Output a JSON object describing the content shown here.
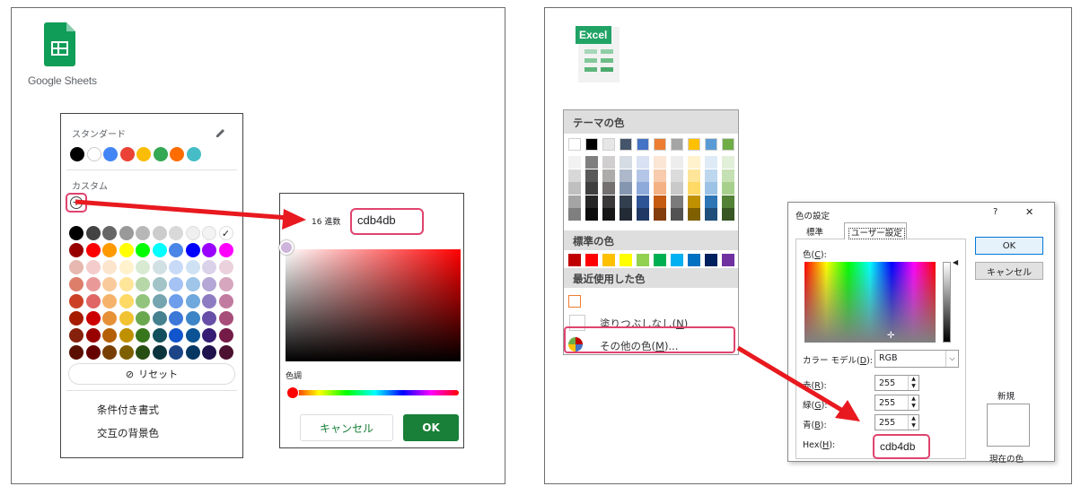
{
  "google": {
    "brand": "Google Sheets",
    "palette": {
      "section_standard": "スタンダード",
      "standard_colors": [
        "#000000",
        "#ffffff",
        "#4285f4",
        "#ea4335",
        "#fbbc04",
        "#34a853",
        "#ff6d01",
        "#46bdc6"
      ],
      "section_custom": "カスタム",
      "grid": [
        [
          "#000000",
          "#434343",
          "#666666",
          "#999999",
          "#b7b7b7",
          "#cccccc",
          "#d9d9d9",
          "#efefef",
          "#f3f3f3",
          "#ffffff"
        ],
        [
          "#980000",
          "#ff0000",
          "#ff9900",
          "#ffff00",
          "#00ff00",
          "#00ffff",
          "#4a86e8",
          "#0000ff",
          "#9900ff",
          "#ff00ff"
        ],
        [
          "#e6b8af",
          "#f4cccc",
          "#fce5cd",
          "#fff2cc",
          "#d9ead3",
          "#d0e0e3",
          "#c9daf8",
          "#cfe2f3",
          "#d9d2e9",
          "#ead1dc"
        ],
        [
          "#dd7e6b",
          "#ea9999",
          "#f9cb9c",
          "#ffe599",
          "#b6d7a8",
          "#a2c4c9",
          "#a4c2f4",
          "#9fc5e8",
          "#b4a7d6",
          "#d5a6bd"
        ],
        [
          "#cc4125",
          "#e06666",
          "#f6b26b",
          "#ffd966",
          "#93c47d",
          "#76a5af",
          "#6d9eeb",
          "#6fa8dc",
          "#8e7cc3",
          "#c27ba0"
        ],
        [
          "#a61c00",
          "#cc0000",
          "#e69138",
          "#f1c232",
          "#6aa84f",
          "#45818e",
          "#3c78d8",
          "#3d85c6",
          "#674ea7",
          "#a64d79"
        ],
        [
          "#85200c",
          "#990000",
          "#b45f06",
          "#bf9000",
          "#38761d",
          "#134f5c",
          "#1155cc",
          "#0b5394",
          "#351c75",
          "#741b47"
        ],
        [
          "#5b0f00",
          "#660000",
          "#783f04",
          "#7f6000",
          "#274e13",
          "#0c343d",
          "#1c4587",
          "#073763",
          "#20124d",
          "#4c1130"
        ]
      ],
      "reset_label": "リセット",
      "menu_conditional": "条件付き書式",
      "menu_alternating": "交互の背景色"
    },
    "picker": {
      "hex_label": "16 進数",
      "hex_value": "cdb4db",
      "hue_label": "色調",
      "cancel_label": "キャンセル",
      "ok_label": "OK",
      "ok_color": "#188038"
    }
  },
  "excel": {
    "logo_text": "Excel",
    "menu": {
      "theme_header": "テーマの色",
      "theme_top": [
        "#ffffff",
        "#000000",
        "#e7e6e6",
        "#44546a",
        "#4472c4",
        "#ed7d31",
        "#a5a5a5",
        "#ffc000",
        "#5b9bd5",
        "#70ad47"
      ],
      "theme_tints": [
        [
          "#f2f2f2",
          "#7f7f7f",
          "#d0cece",
          "#d6dce4",
          "#d9e2f3",
          "#fbe5d5",
          "#ededed",
          "#fff2cc",
          "#deebf6",
          "#e2efd9"
        ],
        [
          "#d8d8d8",
          "#595959",
          "#aeabab",
          "#adb9ca",
          "#b4c6e7",
          "#f7cbac",
          "#dbdbdb",
          "#fee599",
          "#bdd7ee",
          "#c5e0b3"
        ],
        [
          "#bfbfbf",
          "#3f3f3f",
          "#757070",
          "#8496b0",
          "#8eaadb",
          "#f4b183",
          "#c9c9c9",
          "#ffd965",
          "#9cc3e5",
          "#a8d08d"
        ],
        [
          "#a5a5a5",
          "#262626",
          "#3a3838",
          "#323f4f",
          "#2f5496",
          "#c55a11",
          "#7b7b7b",
          "#bf9000",
          "#2e75b5",
          "#538135"
        ],
        [
          "#7f7f7f",
          "#0c0c0c",
          "#171616",
          "#222a35",
          "#1f3864",
          "#833c0b",
          "#525252",
          "#7f6000",
          "#1e4e79",
          "#375623"
        ]
      ],
      "standard_header": "標準の色",
      "standard_colors": [
        "#c00000",
        "#ff0000",
        "#ffc000",
        "#ffff00",
        "#92d050",
        "#00b050",
        "#00b0f0",
        "#0070c0",
        "#002060",
        "#7030a0"
      ],
      "recent_header": "最近使用した色",
      "recent_color": "#ed7d31",
      "no_fill_label": "塗りつぶしなし(",
      "no_fill_key": "N",
      "more_colors_label": "その他の色(",
      "more_colors_key": "M",
      "more_colors_suffix": ")..."
    },
    "dialog": {
      "title": "色の設定",
      "help": "?",
      "close": "✕",
      "tab_standard": "標準",
      "tab_custom": "ユーザー設定",
      "colors_label": "色(",
      "colors_key": "C",
      "model_label": "カラー モデル(",
      "model_key": "D",
      "model_value": "RGB",
      "red_label": "赤(",
      "red_key": "R",
      "red_value": "255",
      "green_label": "緑(",
      "green_key": "G",
      "green_value": "255",
      "blue_label": "青(",
      "blue_key": "B",
      "blue_value": "255",
      "hex_label": "Hex(",
      "hex_key": "H",
      "hex_value": "cdb4db",
      "ok_label": "OK",
      "cancel_label": "キャンセル",
      "new_label": "新規",
      "current_label": "現在の色"
    }
  },
  "annotation_color": "#e0436e",
  "arrow_color": "#e8191f"
}
